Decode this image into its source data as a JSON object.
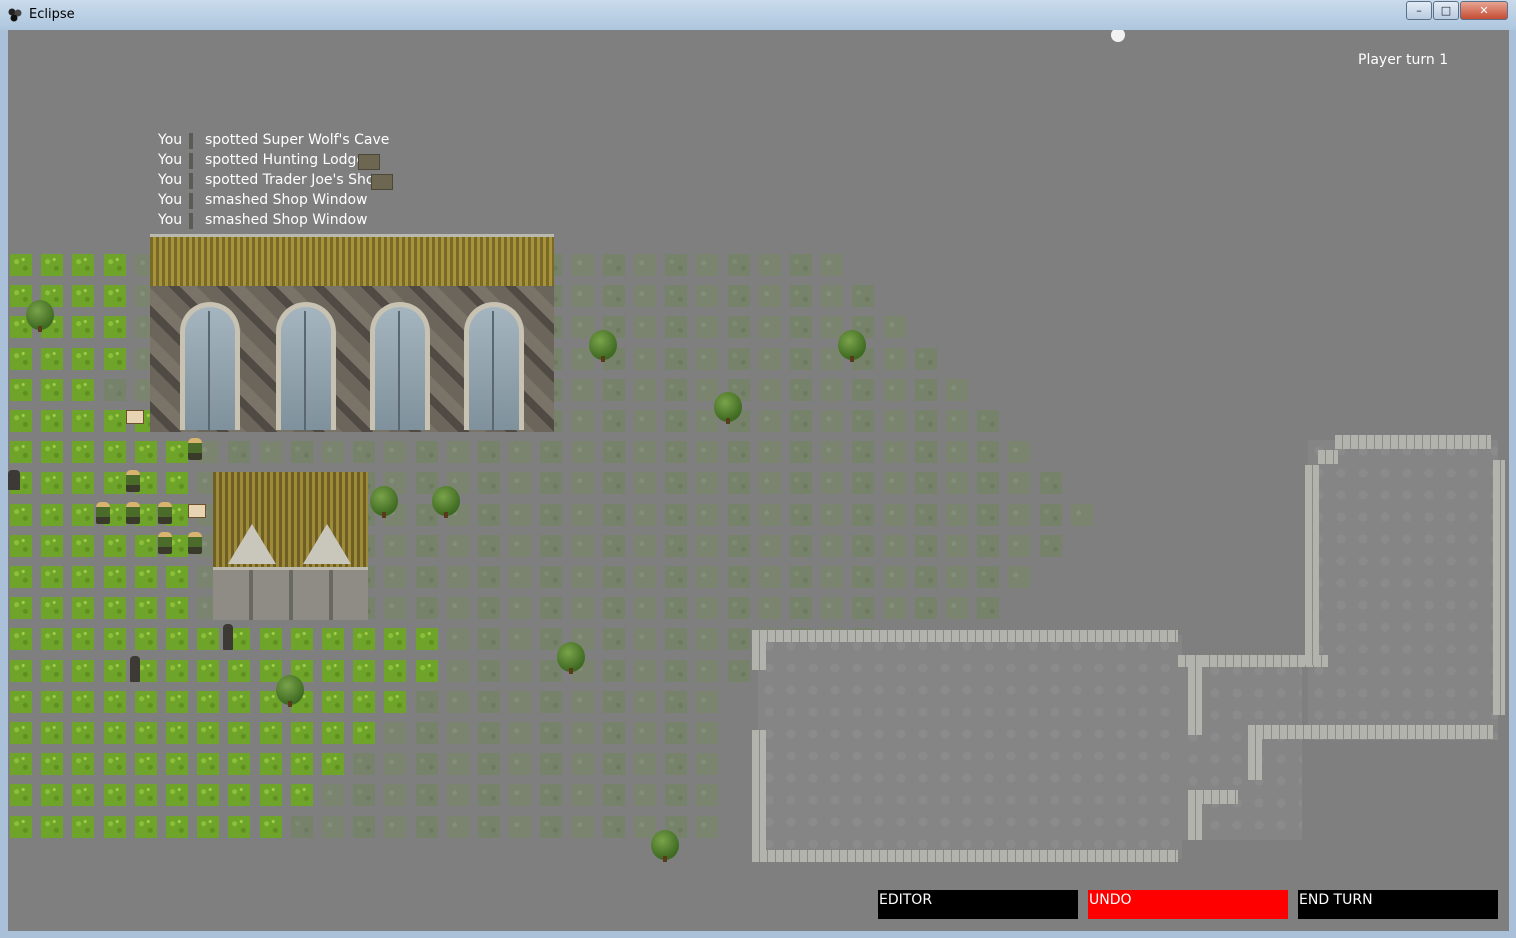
{
  "window": {
    "title": "Eclipse",
    "icon": "eclipse-app-icon",
    "controls": {
      "minimize": "–",
      "maximize": "□",
      "close": "✕"
    }
  },
  "hud": {
    "turn_label": "Player turn 1"
  },
  "log": [
    {
      "who": "You",
      "message": "spotted Super Wolf's Cave"
    },
    {
      "who": "You",
      "message": "spotted Hunting Lodge"
    },
    {
      "who": "You",
      "message": "spotted Trader Joe's Shop"
    },
    {
      "who": "You",
      "message": "smashed Shop Window"
    },
    {
      "who": "You",
      "message": "smashed Shop Window"
    }
  ],
  "buttons": {
    "editor": "EDITOR",
    "undo": "UNDO",
    "end_turn": "END TURN"
  },
  "colors": {
    "background": "#7f7f7f",
    "undo": "#ff0000",
    "button": "#000000",
    "text": "#ffffff"
  }
}
